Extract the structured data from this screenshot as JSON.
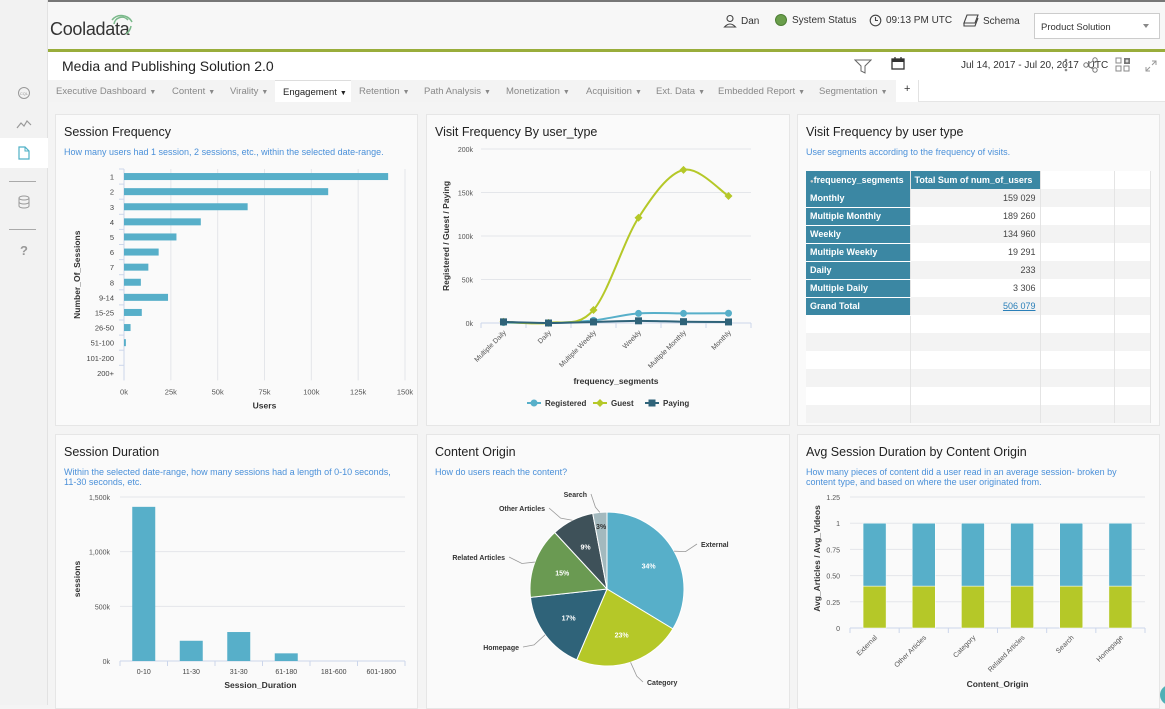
{
  "app": {
    "logo": "Cooladata",
    "user": "Dan",
    "system_status": "System Status",
    "time": "09:13 PM UTC",
    "schema": "Schema",
    "solution_select": "Product Solution"
  },
  "sidebar": {
    "items": [
      {
        "icon": "cql-icon",
        "label": "CQL"
      },
      {
        "icon": "trend-chart-icon"
      },
      {
        "icon": "report-page-icon",
        "active": true
      },
      {
        "icon": "database-icon"
      },
      {
        "icon": "help-icon",
        "label": "?"
      }
    ]
  },
  "page": {
    "title": "Media and Publishing Solution 2.0",
    "date_range": "Jul 14, 2017 - Jul 20, 2017",
    "timezone": "UTC"
  },
  "tabs": [
    {
      "label": "Executive Dashboard"
    },
    {
      "label": "Content"
    },
    {
      "label": "Virality"
    },
    {
      "label": "Engagement",
      "active": true
    },
    {
      "label": "Retention"
    },
    {
      "label": "Path Analysis"
    },
    {
      "label": "Monetization"
    },
    {
      "label": "Acquisition"
    },
    {
      "label": "Ext. Data"
    },
    {
      "label": "Embedded Report"
    },
    {
      "label": "Segmentation"
    },
    {
      "label": "+"
    }
  ],
  "colors": {
    "accent_green": "#99ad3b",
    "blue": "#57afc9",
    "lime": "#b5c828",
    "dark_teal": "#2f6379",
    "table_header": "#3b87a3",
    "subtitle_link": "#4a90d9"
  },
  "panels": {
    "session_frequency": {
      "title": "Session Frequency",
      "subtitle": "How many users had 1 session, 2 sessions, etc., within the selected date-range."
    },
    "visit_frequency_chart": {
      "title": "Visit Frequency By user_type"
    },
    "visit_frequency_table": {
      "title": "Visit Frequency by user type",
      "subtitle": "User segments according to the frequency of visits.",
      "col_headers": [
        "frequency_segments",
        "Total Sum of num_of_users"
      ],
      "rows": [
        {
          "segment": "Monthly",
          "value": "159 029"
        },
        {
          "segment": "Multiple Monthly",
          "value": "189 260"
        },
        {
          "segment": "Weekly",
          "value": "134 960"
        },
        {
          "segment": "Multiple Weekly",
          "value": "19 291"
        },
        {
          "segment": "Daily",
          "value": "233"
        },
        {
          "segment": "Multiple Daily",
          "value": "3 306"
        }
      ],
      "grand_total_label": "Grand Total",
      "grand_total_value": "506 079"
    },
    "session_duration": {
      "title": "Session Duration",
      "subtitle_line1": "Within the selected date-range, how many sessions had a length of 0-10 seconds,",
      "subtitle_line2": "11-30 seconds, etc."
    },
    "content_origin": {
      "title": "Content Origin",
      "subtitle": "How do users reach the content?"
    },
    "avg_session_duration": {
      "title": "Avg Session Duration by Content Origin",
      "subtitle_line1": "How many pieces of content did a user read in an average session- broken by",
      "subtitle_line2": "content type, and based on where the user originated from."
    }
  },
  "chart_data": [
    {
      "id": "session_frequency",
      "type": "bar",
      "orientation": "horizontal",
      "title": "Session Frequency",
      "xlabel": "Users",
      "ylabel": "Number_Of_Sessions",
      "categories": [
        "1",
        "2",
        "3",
        "4",
        "5",
        "6",
        "7",
        "8",
        "9-14",
        "15-25",
        "26-50",
        "51-100",
        "101-200",
        "200+"
      ],
      "values": [
        141000,
        109000,
        66000,
        41000,
        28000,
        18500,
        13000,
        9000,
        23500,
        9500,
        3500,
        1000,
        0,
        0
      ],
      "xlim": [
        0,
        150000
      ],
      "xticks": [
        "0k",
        "25k",
        "50k",
        "75k",
        "100k",
        "125k",
        "150k"
      ],
      "grid": true
    },
    {
      "id": "visit_frequency",
      "type": "line",
      "title": "Visit Frequency By user_type",
      "xlabel": "frequency_segments",
      "ylabel": "Registered / Guest / Paying",
      "categories": [
        "Multiple Daily",
        "Daily",
        "Multiple Weekly",
        "Weekly",
        "Multiple Monthly",
        "Monthly"
      ],
      "series": [
        {
          "name": "Registered",
          "color": "#57afc9",
          "marker": "circle",
          "values": [
            500,
            100,
            3000,
            11000,
            11000,
            11200
          ]
        },
        {
          "name": "Guest",
          "color": "#b5c828",
          "marker": "diamond",
          "values": [
            1500,
            200,
            15000,
            121000,
            176000,
            146000
          ]
        },
        {
          "name": "Paying",
          "color": "#2f6379",
          "marker": "square",
          "values": [
            1300,
            0,
            1200,
            2500,
            1500,
            1200
          ]
        }
      ],
      "ylim": [
        0,
        200000
      ],
      "yticks": [
        "0k",
        "50k",
        "100k",
        "150k",
        "200k"
      ],
      "legend": "bottom",
      "grid": true
    },
    {
      "id": "session_duration",
      "type": "bar",
      "title": "Session Duration",
      "xlabel": "Session_Duration",
      "ylabel": "sessions",
      "categories": [
        "0-10",
        "11-30",
        "31-30",
        "61-180",
        "181-600",
        "601-1800"
      ],
      "values": [
        1410000,
        185000,
        265000,
        70000,
        0,
        0
      ],
      "ylim": [
        0,
        1500000
      ],
      "yticks": [
        "0k",
        "500k",
        "1,000k",
        "1,500k"
      ],
      "grid": true
    },
    {
      "id": "content_origin",
      "type": "pie",
      "title": "Content Origin",
      "slices": [
        {
          "label": "External",
          "value": 34,
          "color": "#57afc9"
        },
        {
          "label": "Category",
          "value": 23,
          "color": "#b5c828"
        },
        {
          "label": "Homepage",
          "value": 17,
          "color": "#2f6379"
        },
        {
          "label": "Related Articles",
          "value": 15,
          "color": "#6a9a52"
        },
        {
          "label": "Other Articles",
          "value": 9,
          "color": "#3e5159"
        },
        {
          "label": "Search",
          "value": 3,
          "color": "#a3b9be"
        }
      ]
    },
    {
      "id": "avg_session_duration",
      "type": "bar",
      "stacked": true,
      "title": "Avg Session Duration by Content Origin",
      "xlabel": "Content_Origin",
      "ylabel": "Avg_Articles / Avg_Videos",
      "categories": [
        "External",
        "Other Articles",
        "Category",
        "Related Articles",
        "Search",
        "Homepage"
      ],
      "series": [
        {
          "name": "Avg_Videos",
          "color": "#b5c828",
          "values": [
            0.4,
            0.4,
            0.4,
            0.4,
            0.4,
            0.4
          ]
        },
        {
          "name": "Avg_Articles",
          "color": "#57afc9",
          "values": [
            0.6,
            0.6,
            0.6,
            0.6,
            0.6,
            0.6
          ]
        }
      ],
      "ylim": [
        0,
        1.25
      ],
      "yticks": [
        "0",
        "0.25",
        "0.50",
        "0.75",
        "1",
        "1.25"
      ],
      "grid": true
    }
  ]
}
